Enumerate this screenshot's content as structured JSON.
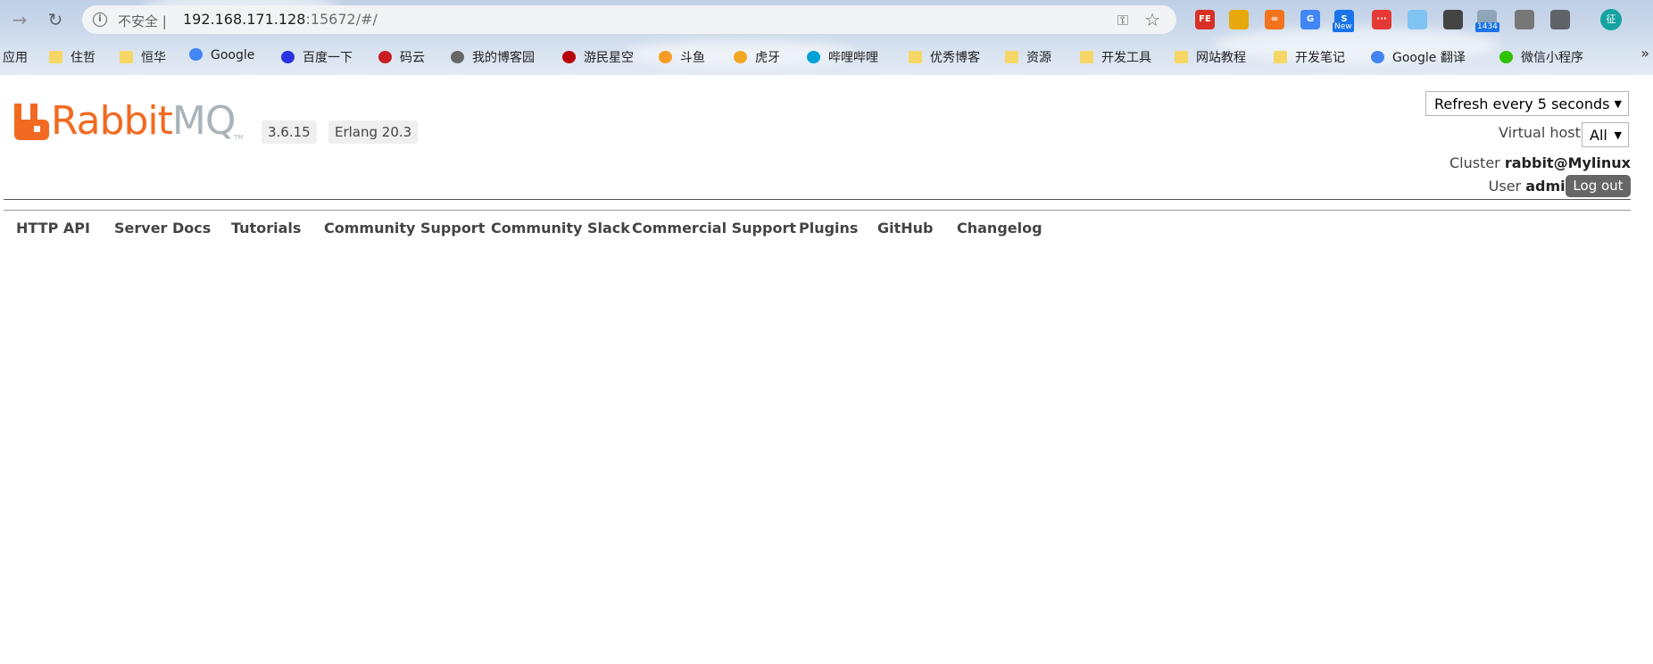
{
  "browser": {
    "insecure_label": "不安全",
    "url_host": "192.168.171.128",
    "url_rest": ":15672/#/",
    "extensions": [
      {
        "name": "FE",
        "color": "#d93025"
      },
      {
        "name": "",
        "color": "#e8a90c"
      },
      {
        "name": "∞",
        "color": "#f2731c"
      },
      {
        "name": "G",
        "color": "#4285f4"
      },
      {
        "name": "S",
        "color": "#1a73e8",
        "badge": "New"
      },
      {
        "name": "···",
        "color": "#e53935"
      },
      {
        "name": "",
        "color": "#7fc4f2"
      },
      {
        "name": "",
        "color": "#444444"
      },
      {
        "name": "",
        "color": "#8fa6b8",
        "badge": "1434"
      },
      {
        "name": "",
        "color": "#777777"
      },
      {
        "name": "",
        "color": "#5f6368"
      }
    ],
    "profile_initial": "征"
  },
  "bookmarks": [
    {
      "label": "应用",
      "icon": "apps-icon"
    },
    {
      "label": "住哲",
      "icon": "folder-icon"
    },
    {
      "label": "恒华",
      "icon": "folder-icon"
    },
    {
      "label": "Google",
      "icon": "google-icon"
    },
    {
      "label": "百度一下",
      "icon": "baidu-icon"
    },
    {
      "label": "码云",
      "icon": "gitee-icon"
    },
    {
      "label": "我的博客园",
      "icon": "cnblogs-icon"
    },
    {
      "label": "游民星空",
      "icon": "gamersky-icon"
    },
    {
      "label": "斗鱼",
      "icon": "douyu-icon"
    },
    {
      "label": "虎牙",
      "icon": "huya-icon"
    },
    {
      "label": "哔哩哔哩",
      "icon": "bilibili-icon"
    },
    {
      "label": "优秀博客",
      "icon": "folder-icon"
    },
    {
      "label": "资源",
      "icon": "folder-icon"
    },
    {
      "label": "开发工具",
      "icon": "folder-icon"
    },
    {
      "label": "网站教程",
      "icon": "folder-icon"
    },
    {
      "label": "开发笔记",
      "icon": "folder-icon"
    },
    {
      "label": "Google 翻译",
      "icon": "google-translate-icon"
    },
    {
      "label": "微信小程序",
      "icon": "wechat-icon"
    }
  ],
  "header": {
    "logo_rabbit": "Rabbit",
    "logo_mq": "MQ",
    "logo_tm": "TM",
    "version": "3.6.15",
    "erlang": "Erlang 20.3",
    "refresh_value": "Refresh every 5 seconds",
    "vhost_label": "Virtual host",
    "vhost_value": "All",
    "cluster_label": "Cluster",
    "cluster_value": "rabbit@Mylinux",
    "user_label": "User",
    "user_value": "admin",
    "logout_label": "Log out"
  },
  "footer_links": [
    "HTTP API",
    "Server Docs",
    "Tutorials",
    "Community Support",
    "Community Slack",
    "Commercial Support",
    "Plugins",
    "GitHub",
    "Changelog"
  ],
  "colors": {
    "brand_orange": "#f26a21",
    "brand_grey": "#a9b3b8",
    "logout_bg": "#666666"
  }
}
